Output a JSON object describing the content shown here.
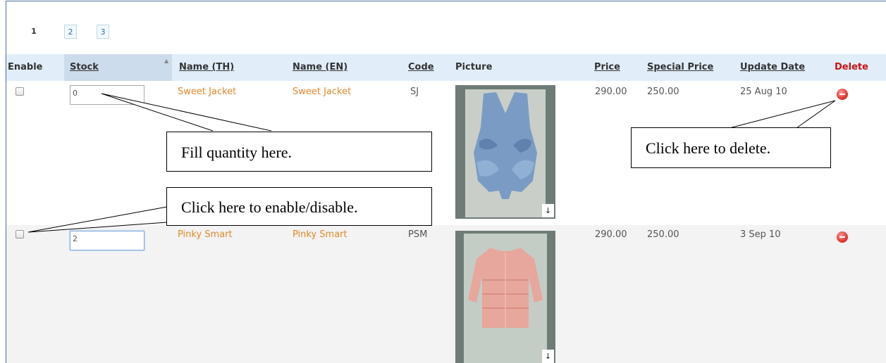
{
  "pager": {
    "current": "1",
    "pages": [
      "2",
      "3"
    ]
  },
  "table": {
    "headers": {
      "enable": "Enable",
      "stock": "Stock",
      "name_th": "Name (TH)",
      "name_en": "Name (EN)",
      "code": "Code",
      "picture": "Picture",
      "price": "Price",
      "special_price": "Special Price",
      "update_date": "Update Date",
      "delete": "Delete"
    },
    "rows": [
      {
        "enabled": false,
        "stock": "0",
        "name_th": "Sweet Jacket",
        "name_en": "Sweet Jacket",
        "code": "SJ",
        "price": "290.00",
        "special_price": "250.00",
        "update_date": "25 Aug 10"
      },
      {
        "enabled": false,
        "stock": "2",
        "name_th": "Pinky Smart",
        "name_en": "Pinky Smart",
        "code": "PSM",
        "price": "290.00",
        "special_price": "250.00",
        "update_date": "3 Sep 10"
      }
    ]
  },
  "callouts": {
    "quantity": "Fill quantity here.",
    "enable": "Click here to enable/disable.",
    "delete": "Click here to delete."
  },
  "colors": {
    "header_bg": "#e1eef9",
    "name_link": "#e08a2b",
    "delete_header": "#cc1111",
    "delete_icon": "#e0382e"
  }
}
